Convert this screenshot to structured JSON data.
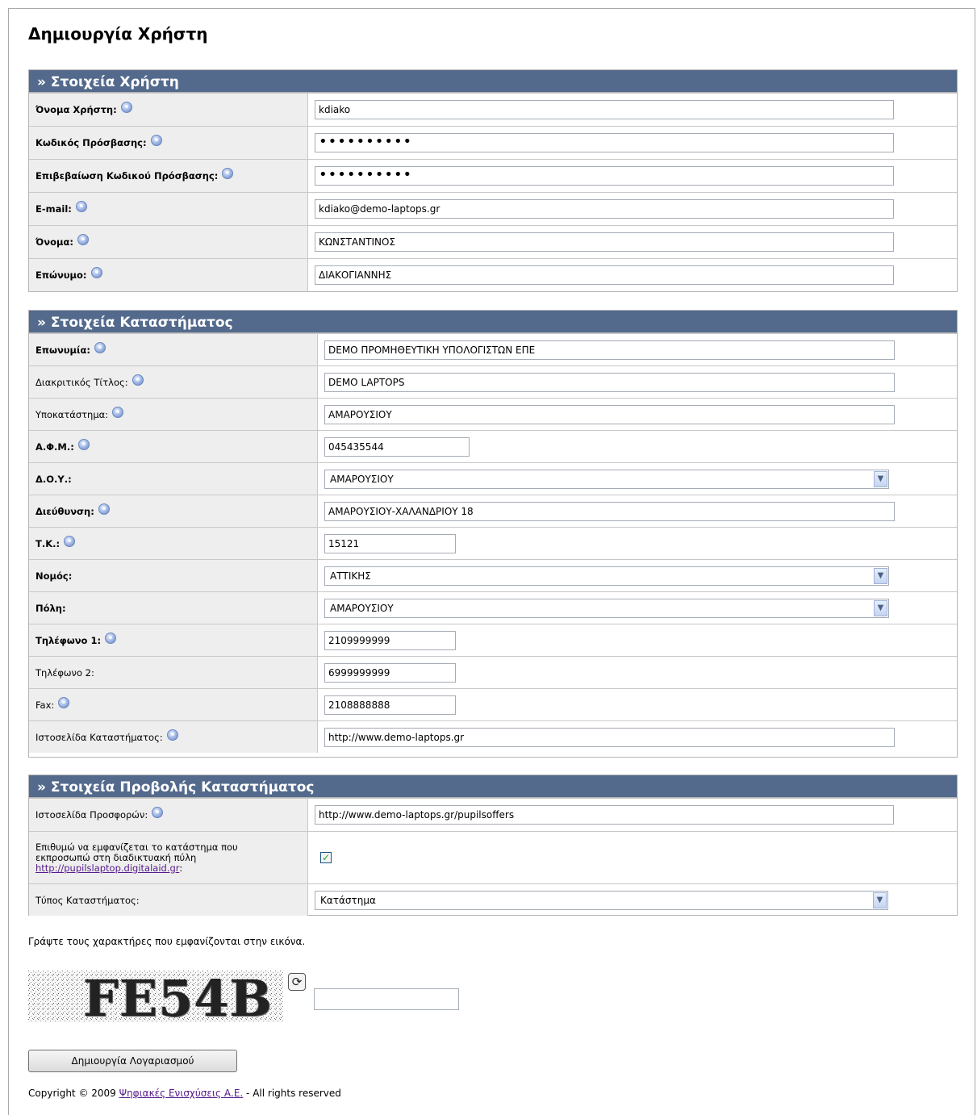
{
  "page_title": "Δημιουργία Χρήστη",
  "user_section": {
    "header": "» Στοιχεία Χρήστη",
    "fields": [
      {
        "label": "Όνομα Χρήστη:",
        "value": "kdiako"
      },
      {
        "label": "Κωδικός Πρόσβασης:",
        "value": "••••••••••"
      },
      {
        "label": "Επιβεβαίωση Κωδικού Πρόσβασης:",
        "value": "••••••••••"
      },
      {
        "label": "E-mail:",
        "value": "kdiako@demo-laptops.gr"
      },
      {
        "label": "Όνομα:",
        "value": "ΚΩΝΣΤΑΝΤΙΝΟΣ"
      },
      {
        "label": "Επώνυμο:",
        "value": "ΔΙΑΚΟΓΙΑΝΝΗΣ"
      }
    ]
  },
  "store_section": {
    "header": "» Στοιχεία Καταστήματος",
    "fields": [
      {
        "label": "Επωνυμία:",
        "value": "DEMO ΠΡΟΜΗΘΕΥΤΙΚΗ ΥΠΟΛΟΓΙΣΤΩΝ ΕΠΕ"
      },
      {
        "label": "Διακριτικός Τίτλος:",
        "value": "DEMO LAPTOPS"
      },
      {
        "label": "Υποκατάστημα:",
        "value": "ΑΜΑΡΟΥΣΙΟΥ"
      },
      {
        "label": "Α.Φ.Μ.:",
        "value": "045435544"
      },
      {
        "label": "Δ.Ο.Υ.:",
        "value": "ΑΜΑΡΟΥΣΙΟΥ"
      },
      {
        "label": "Διεύθυνση:",
        "value": "ΑΜΑΡΟΥΣΙΟΥ-ΧΑΛΑΝΔΡΙΟΥ 18"
      },
      {
        "label": "Τ.Κ.:",
        "value": "15121"
      },
      {
        "label": "Νομός:",
        "value": "ΑΤΤΙΚΗΣ"
      },
      {
        "label": "Πόλη:",
        "value": "ΑΜΑΡΟΥΣΙΟΥ"
      },
      {
        "label": "Τηλέφωνο 1:",
        "value": "2109999999"
      },
      {
        "label": "Τηλέφωνο 2:",
        "value": "6999999999"
      },
      {
        "label": "Fax:",
        "value": "2108888888"
      },
      {
        "label": "Ιστοσελίδα Καταστήματος:",
        "value": "http://www.demo-laptops.gr"
      }
    ]
  },
  "display_section": {
    "header": "» Στοιχεία Προβολής Καταστήματος",
    "offers_label": "Ιστοσελίδα Προσφορών:",
    "offers_value": "http://www.demo-laptops.gr/pupilsoffers",
    "show_label_1": "Επιθυμώ να εμφανίζεται το κατάστημα που",
    "show_label_2": "εκπροσωπώ στη διαδικτυακή πύλη",
    "show_link": "http://pupilslaptop.digitalaid.gr",
    "show_label_suffix": ":",
    "show_checked": "✓",
    "type_label": "Τύπος Καταστήματος:",
    "type_value": "Κατάστημα"
  },
  "captcha": {
    "instruction": "Γράψτε τους χαρακτήρες που εμφανίζονται στην εικόνα.",
    "text": "FE54B",
    "input_value": ""
  },
  "submit_label": "Δημιουργία Λογαριασμού",
  "footer": {
    "prefix": "Copyright © 2009 ",
    "company": "Ψηφιακές Ενισχύσεις Α.Ε.",
    "suffix": " - All rights reserved"
  }
}
